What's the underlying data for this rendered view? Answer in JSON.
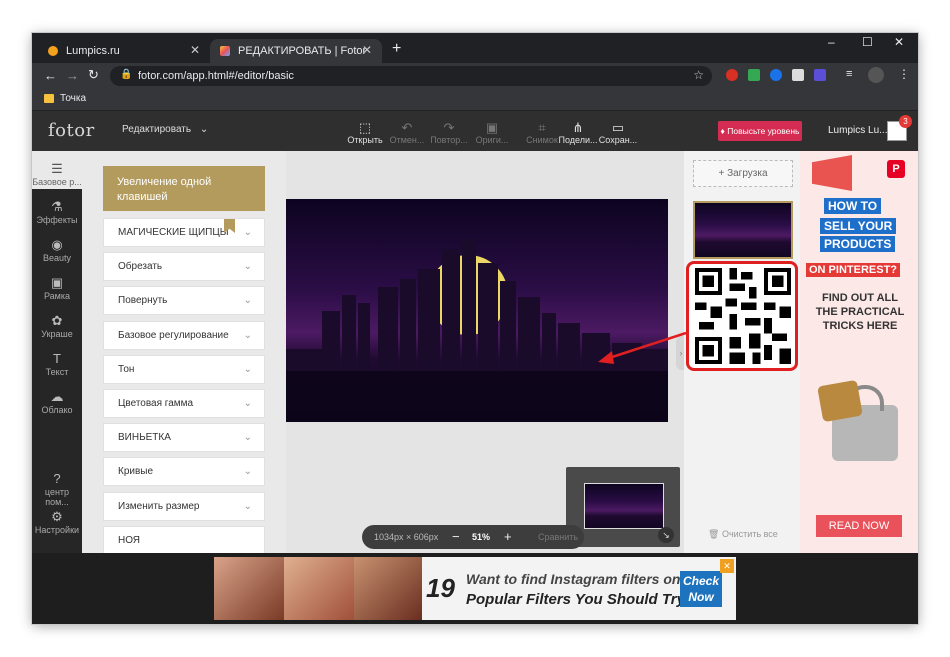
{
  "browser": {
    "tabs": [
      {
        "title": "Lumpics.ru",
        "active": false
      },
      {
        "title": "РЕДАКТИРОВАТЬ | Fotor",
        "active": true
      }
    ],
    "new_tab": "+",
    "url": "fotor.com/app.html#/editor/basic",
    "bookmark": "Точка",
    "window_controls": {
      "minimize": "–",
      "maximize": "☐",
      "close": "✕"
    }
  },
  "app": {
    "logo": "fotor",
    "mode_menu": "Редактировать",
    "toolbar": [
      {
        "label": "Открыть",
        "icon": "open-icon",
        "enabled": true
      },
      {
        "label": "Отмен...",
        "icon": "undo-icon",
        "enabled": false
      },
      {
        "label": "Повтор...",
        "icon": "redo-icon",
        "enabled": false
      },
      {
        "label": "Ориги...",
        "icon": "original-icon",
        "enabled": false
      },
      {
        "label": "Снимок",
        "icon": "snapshot-icon",
        "enabled": false
      },
      {
        "label": "Подели...",
        "icon": "share-icon",
        "enabled": true
      },
      {
        "label": "Сохран...",
        "icon": "save-icon",
        "enabled": true
      }
    ],
    "upgrade_button": "Повысьте уровень",
    "user_name": "Lumpics Lu...",
    "notif_count": "3",
    "rail": [
      {
        "label": "Базовое р...",
        "icon": "sliders-icon"
      },
      {
        "label": "Эффекты",
        "icon": "flask-icon"
      },
      {
        "label": "Beauty",
        "icon": "eye-icon"
      },
      {
        "label": "Рамка",
        "icon": "frame-icon"
      },
      {
        "label": "Украше",
        "icon": "decor-icon"
      },
      {
        "label": "Текст",
        "icon": "text-icon"
      },
      {
        "label": "Облако",
        "icon": "cloud-icon"
      },
      {
        "label": "центр пом...",
        "icon": "help-icon"
      },
      {
        "label": "Настройки",
        "icon": "settings-icon"
      }
    ],
    "panel": {
      "highlight": "Увеличение одной клавишей",
      "items": [
        "МАГИЧЕСКИЕ ЩИПЦЫ",
        "Обрезать",
        "Повернуть",
        "Базовое регулирование",
        "Тон",
        "Цветовая гамма",
        "ВИНЬЕТКА",
        "Кривые",
        "Изменить размер",
        "НОЯ"
      ]
    },
    "status": {
      "size": "1034px × 606px",
      "zoom": "51%",
      "compare": "Сравнить",
      "minus": "−",
      "plus": "+"
    },
    "right": {
      "upload": "Загрузка",
      "clear": "Очистить все"
    },
    "ad_right": {
      "line1": "HOW TO",
      "line2": "SELL YOUR",
      "line3": "PRODUCTS",
      "line4": "ON PINTEREST?",
      "body": "FIND OUT ALL THE PRACTICAL TRICKS HERE",
      "cta": "READ NOW",
      "p_logo": "P"
    },
    "ad_bottom": {
      "number": "19",
      "line1": "Want to find Instagram filters online?",
      "line2": "Popular Filters You Should Try",
      "cta": "Check Now",
      "close": "✕"
    }
  },
  "colors": {
    "accent_gold": "#b39a5d",
    "upgrade_red": "#d42c53",
    "annotation_red": "#e02020",
    "read_now": "#e9525a"
  }
}
